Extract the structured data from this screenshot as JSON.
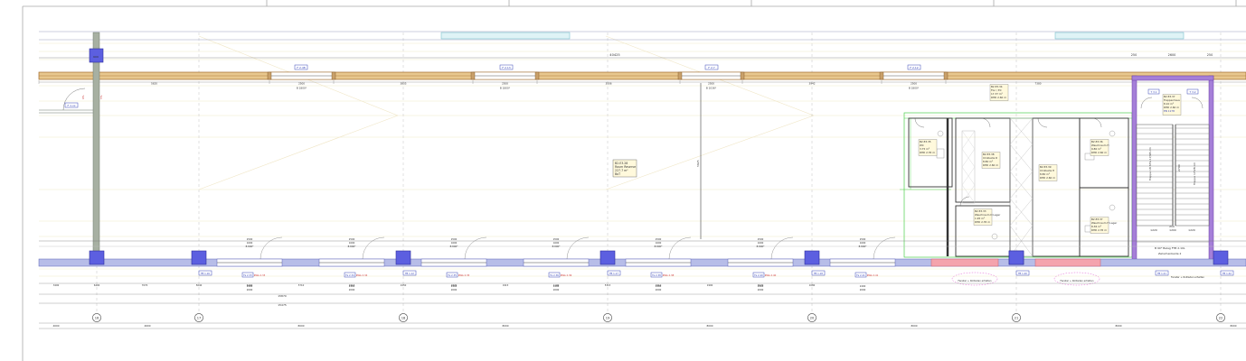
{
  "drawing": {
    "overall_dim": "40425",
    "right_dims": [
      "250",
      "2600",
      "250"
    ],
    "mid_dim": "5925",
    "bottom_totals": [
      "15870",
      "15475"
    ],
    "top_segments": [
      {
        "len": "5620"
      },
      {
        "len": "2500",
        "sub": "B 1800*"
      },
      {
        "len": "3835"
      },
      {
        "len": "2500",
        "sub": "B 1800*"
      },
      {
        "len": "3506"
      },
      {
        "len": "2500",
        "sub": "B 1036*"
      },
      {
        "len": "3942"
      },
      {
        "len": "2500",
        "sub": "B 1800*"
      },
      {
        "len": "7380"
      }
    ],
    "window_tags_top": [
      "F 2.48",
      "F 2.13",
      "F 2.7",
      "F 2.12"
    ],
    "column_axes": [
      "16",
      "17",
      "18",
      "19",
      "20",
      "21",
      "22"
    ],
    "axis_spacings": [
      "4000",
      "4600",
      "8000",
      "8000",
      "8000",
      "8000",
      "8000",
      "8000"
    ],
    "bottom_windows": [
      {
        "tag": "Fe 2.33",
        "note": "RWA 2.33",
        "w": "2400",
        "h": "2000"
      },
      {
        "tag": "Fe 2.34",
        "note": "RWA 2.34",
        "w": "2400",
        "h": "2000"
      },
      {
        "tag": "Fe 2.35",
        "note": "RWA 2.35",
        "w": "2400",
        "h": "2000"
      },
      {
        "tag": "Fe 2.36",
        "note": "RWA 2.36",
        "w": "2400",
        "h": "2000"
      },
      {
        "tag": "Fe 2.38",
        "note": "RWA 2.38",
        "w": "2400",
        "h": "2000"
      },
      {
        "tag": "Fe 2.40",
        "note": "RWA 2.40",
        "w": "2400",
        "h": "2000"
      },
      {
        "tag": "Fe 2.41",
        "note": "RWA 2.41",
        "w": "2400",
        "h": "2000"
      }
    ],
    "bottom_door_dims": [
      "2500",
      "1600",
      "B 800*"
    ],
    "bottom_chain": [
      "3400",
      "6400",
      "7070",
      "5640",
      "6400",
      "5710",
      "1915",
      "2450",
      "1870",
      "1915",
      "1100",
      "5315",
      "1910",
      "1900",
      "3070",
      "1080"
    ],
    "small_tags": [
      "FB 1.16",
      "FB 1.12",
      "FB 1.17",
      "FB 1.18",
      "FB 1.20",
      "FB 1.21",
      "FB 1.42",
      "FB 1.44"
    ],
    "lower_notes": [
      "Fenster + Rollladen erhalten",
      "Fenster + Rollladen erhalten",
      "Fenster + Rollladen erhalten"
    ],
    "main_room": {
      "id": "B2.E3.28",
      "name": "Raum Reserve",
      "area": "227.7 m²",
      "sub": "BoT"
    },
    "rooms": [
      {
        "id": "B2.E3.34",
        "name": "Flur / Eil",
        "area": "17.37 m²",
        "height": "RHD 2.60 m"
      },
      {
        "id": "B2.E3.37",
        "name": "Treppenhaus",
        "area": "8.10 m²",
        "height": "RHD 2.60 m",
        "extra": "EN 1178"
      },
      {
        "id": "B2.E3.35",
        "name": "WC",
        "area": "3.75 m²",
        "height": "RHD 2.35 m"
      },
      {
        "id": "B2.E3.38",
        "name": "Umkleide D",
        "area": "8.80 m²",
        "height": "RHD 2.60 m"
      },
      {
        "id": "B2.E3.39",
        "name": "Umkleide H",
        "area": "8.80 m²",
        "height": "RHD 2.60 m"
      },
      {
        "id": "B2.E3.36",
        "name": "Waschraum H",
        "area": "9.80 m²",
        "height": "RHD 2.60 m"
      },
      {
        "id": "B2.E3.33",
        "name": "Waschraum D Lager",
        "area": "1.95 m²",
        "height": "RHD 2.35 m"
      },
      {
        "id": "B2.E3.37",
        "name": "Waschraum H Lager",
        "area": "8.36 m²",
        "height": "RHD 2.35 m"
      }
    ],
    "stair": {
      "label": "Treppe 18 STG 17/28 cm",
      "label2": "Treppe 17/28 cm",
      "width": "1200",
      "height": "2700",
      "note": "B 90* Belag FTB 2.10L",
      "note2": "Zwischenbeide 2"
    },
    "small_marks": [
      "210",
      "1220",
      "1220",
      "5652",
      "1260",
      "25"
    ]
  }
}
